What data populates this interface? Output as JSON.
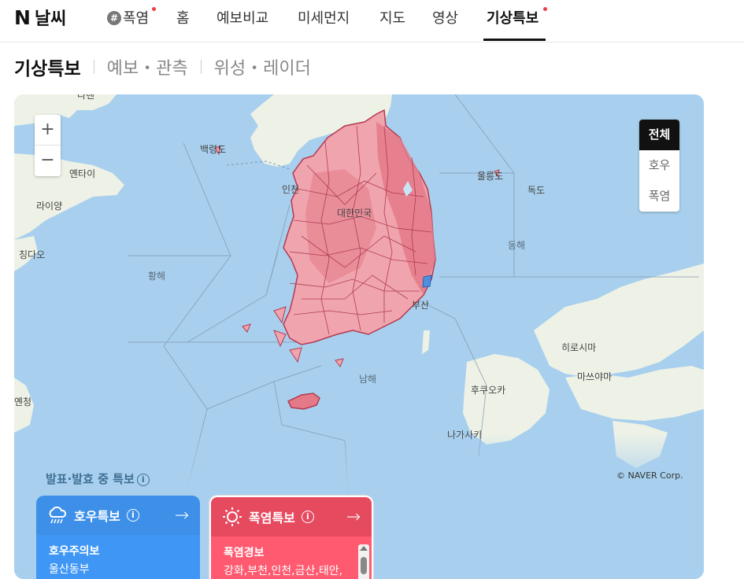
{
  "app": {
    "logo_mark": "N",
    "logo_text": "날씨"
  },
  "nav": {
    "items": [
      {
        "label": "폭염",
        "hash": "#",
        "dot": true
      },
      {
        "label": "홈"
      },
      {
        "label": "예보비교"
      },
      {
        "label": "미세먼지"
      },
      {
        "label": "지도"
      },
      {
        "label": "영상"
      },
      {
        "label": "기상특보",
        "active": true,
        "dot": true
      }
    ]
  },
  "subnav": {
    "current": "기상특보",
    "items": [
      "예보・관측",
      "위성・레이더"
    ]
  },
  "map": {
    "zoom_in": "+",
    "zoom_out": "−",
    "filters": [
      {
        "label": "전체",
        "active": true
      },
      {
        "label": "호우"
      },
      {
        "label": "폭염"
      }
    ],
    "places": {
      "dalian": "다롄",
      "baengnyeongdo": "백령도",
      "yantai": "옌타이",
      "laiyang": "라이양",
      "qingdao": "칭다오",
      "incheon": "인천",
      "daehanminguk": "대한민국",
      "ulleungdo": "울릉도",
      "dokdo": "독도",
      "busan": "부산",
      "hiroshima": "히로시마",
      "matsuyama": "마쓰야마",
      "fukuoka": "후쿠오카",
      "nagasaki": "나가사키",
      "yancheng": "옌청"
    },
    "seas": {
      "yellow_sea": "황해",
      "east_sea": "동해",
      "south_sea": "남해"
    },
    "copyright": "© NAVER Corp."
  },
  "panel": {
    "title": "발표·발효 중 특보",
    "info_icon": "i",
    "cards": [
      {
        "title": "호우특보",
        "icon": "rain-cloud-icon",
        "color": "#3d8fe8",
        "level": "호우주의보",
        "regions": "울산동부",
        "arrow": "→"
      },
      {
        "title": "폭염특보",
        "icon": "sun-icon",
        "color": "#e64a5f",
        "level": "폭염경보",
        "regions": "강화,부천,인천,금산,태안,",
        "arrow": "→"
      }
    ]
  }
}
